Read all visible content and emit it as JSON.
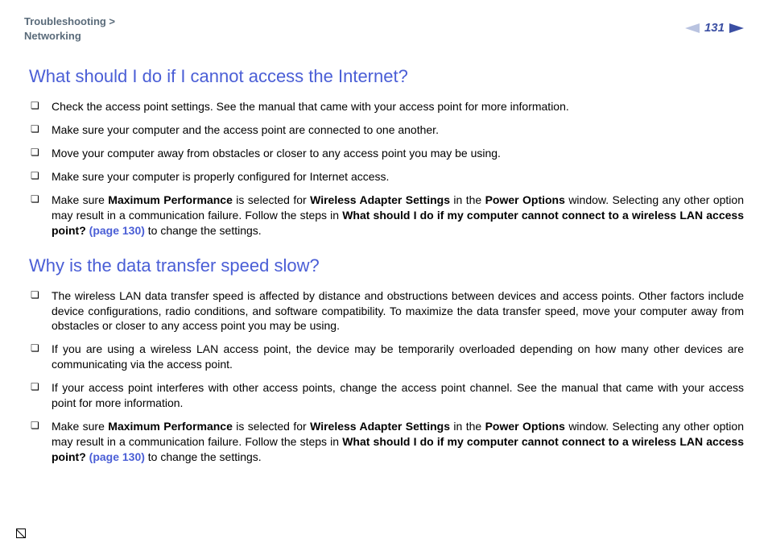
{
  "breadcrumb": {
    "line1": "Troubleshooting >",
    "line2": "Networking"
  },
  "page_number": "131",
  "sections": [
    {
      "heading": "What should I do if I cannot access the Internet?",
      "items": [
        [
          {
            "t": "Check the access point settings. See the manual that came with your access point for more information."
          }
        ],
        [
          {
            "t": "Make sure your computer and the access point are connected to one another."
          }
        ],
        [
          {
            "t": "Move your computer away from obstacles or closer to any access point you may be using."
          }
        ],
        [
          {
            "t": "Make sure your computer is properly configured for Internet access."
          }
        ],
        [
          {
            "t": "Make sure "
          },
          {
            "t": "Maximum Performance",
            "b": true
          },
          {
            "t": " is selected for "
          },
          {
            "t": "Wireless Adapter Settings",
            "b": true
          },
          {
            "t": " in the "
          },
          {
            "t": "Power Options",
            "b": true
          },
          {
            "t": " window. Selecting any other option may result in a communication failure. Follow the steps in "
          },
          {
            "t": "What should I do if my computer cannot connect to a wireless LAN access point? ",
            "b": true
          },
          {
            "t": "(page 130)",
            "link": true
          },
          {
            "t": " to change the settings."
          }
        ]
      ]
    },
    {
      "heading": "Why is the data transfer speed slow?",
      "items": [
        [
          {
            "t": "The wireless LAN data transfer speed is affected by distance and obstructions between devices and access points. Other factors include device configurations, radio conditions, and software compatibility. To maximize the data transfer speed, move your computer away from obstacles or closer to any access point you may be using."
          }
        ],
        [
          {
            "t": "If you are using a wireless LAN access point, the device may be temporarily overloaded depending on how many other devices are communicating via the access point."
          }
        ],
        [
          {
            "t": "If your access point interferes with other access points, change the access point channel. See the manual that came with your access point for more information."
          }
        ],
        [
          {
            "t": "Make sure "
          },
          {
            "t": "Maximum Performance",
            "b": true
          },
          {
            "t": " is selected for "
          },
          {
            "t": "Wireless Adapter Settings",
            "b": true
          },
          {
            "t": " in the "
          },
          {
            "t": "Power Options",
            "b": true
          },
          {
            "t": " window. Selecting any other option may result in a communication failure. Follow the steps in "
          },
          {
            "t": "What should I do if my computer cannot connect to a wireless LAN access point? ",
            "b": true
          },
          {
            "t": "(page 130)",
            "link": true
          },
          {
            "t": " to change the settings."
          }
        ]
      ]
    }
  ]
}
